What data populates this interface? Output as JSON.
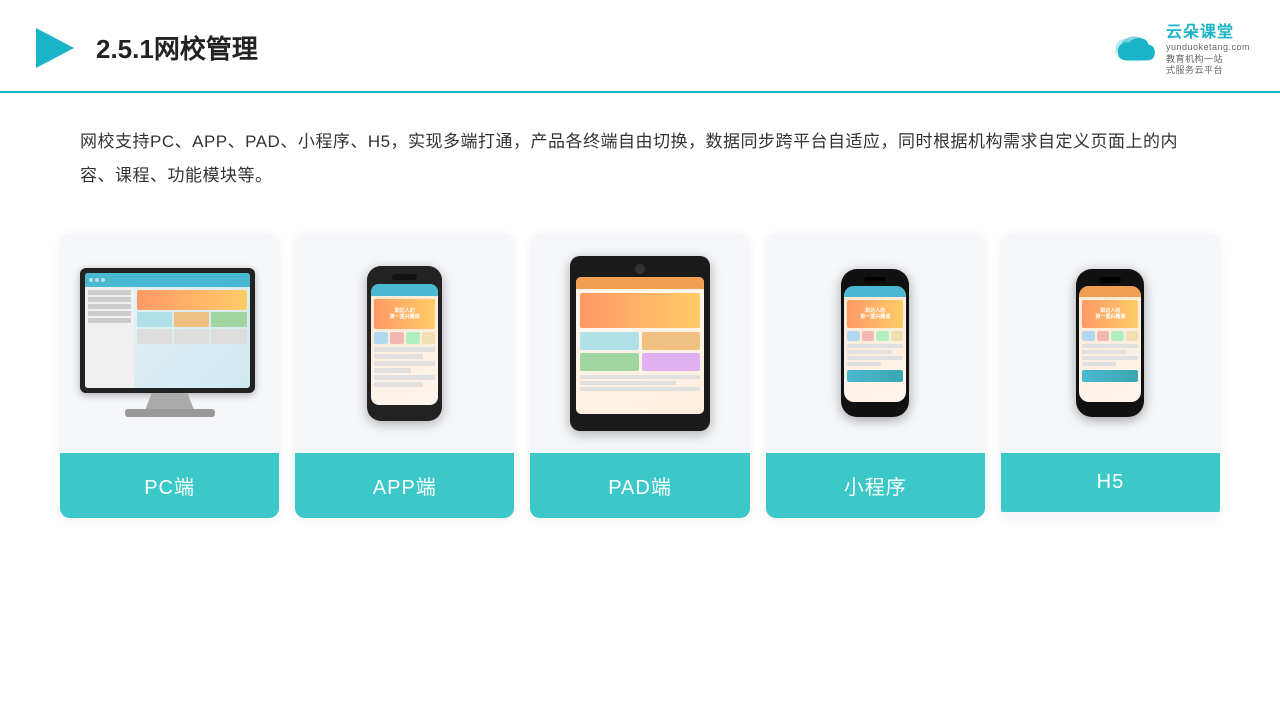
{
  "header": {
    "title": "2.5.1网校管理",
    "brand_name": "云朵课堂",
    "brand_domain": "yunduoketang.com",
    "brand_sub1": "教育机构一站",
    "brand_sub2": "式服务云平台"
  },
  "description": {
    "text": "网校支持PC、APP、PAD、小程序、H5，实现多端打通，产品各终端自由切换，数据同步跨平台自适应，同时根据机构需求自定义页面上的内容、课程、功能模块等。"
  },
  "cards": [
    {
      "id": "pc",
      "label": "PC端"
    },
    {
      "id": "app",
      "label": "APP端"
    },
    {
      "id": "pad",
      "label": "PAD端"
    },
    {
      "id": "miniprogram",
      "label": "小程序"
    },
    {
      "id": "h5",
      "label": "H5"
    }
  ]
}
